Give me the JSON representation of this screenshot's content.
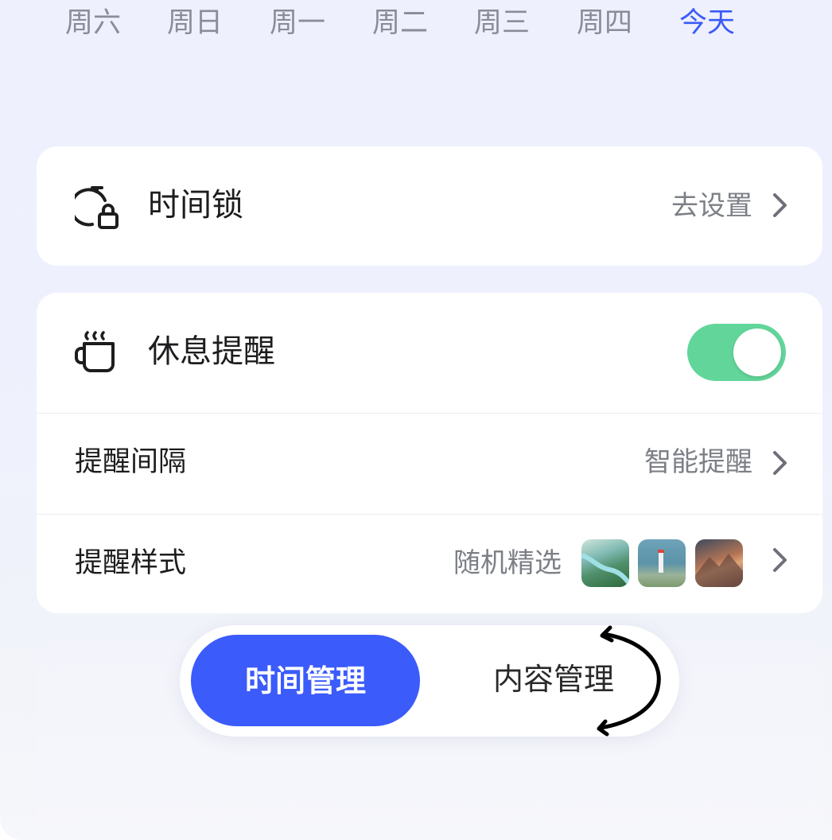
{
  "days": [
    {
      "label": "周六",
      "today": false
    },
    {
      "label": "周日",
      "today": false
    },
    {
      "label": "周一",
      "today": false
    },
    {
      "label": "周二",
      "today": false
    },
    {
      "label": "周三",
      "today": false
    },
    {
      "label": "周四",
      "today": false
    },
    {
      "label": "今天",
      "today": true
    }
  ],
  "time_lock": {
    "label": "时间锁",
    "value": "去设置",
    "icon": "stopwatch-lock-icon"
  },
  "rest_reminder": {
    "label": "休息提醒",
    "icon": "coffee-cup-icon",
    "enabled": true
  },
  "reminder_interval": {
    "label": "提醒间隔",
    "value": "智能提醒"
  },
  "reminder_style": {
    "label": "提醒样式",
    "value": "随机精选",
    "thumbnails": [
      "river-landscape-thumbnail",
      "lighthouse-thumbnail",
      "mountain-sunset-thumbnail"
    ]
  },
  "bottom_tabs": {
    "active": "时间管理",
    "inactive": "内容管理"
  },
  "colors": {
    "accent": "#3b5bfb",
    "toggle_on": "#62d69a",
    "today": "#3b5bf6",
    "muted_text": "#7c7f86"
  }
}
